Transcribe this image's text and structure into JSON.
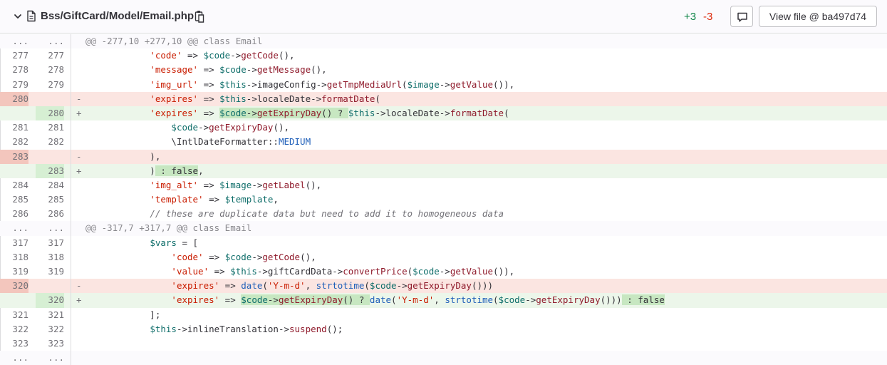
{
  "header": {
    "file_path": "Bss/GiftCard/Model/Email.php",
    "added": "+3",
    "removed": "-3",
    "view_file_label": "View file @ ba497d74",
    "icons": [
      "chevron-down-icon",
      "file-icon",
      "copy-icon",
      "comment-icon"
    ],
    "colors": {
      "added": "#108548",
      "removed": "#dd2b0e"
    }
  },
  "diff": {
    "lines": [
      {
        "type": "match",
        "old": "...",
        "new": "...",
        "marker": "",
        "code": "@@ -277,10 +277,10 @@ class Email"
      },
      {
        "type": "ctx",
        "old": "277",
        "new": "277",
        "marker": "",
        "code": "            'code' => $code->getCode(),"
      },
      {
        "type": "ctx",
        "old": "278",
        "new": "278",
        "marker": "",
        "code": "            'message' => $code->getMessage(),"
      },
      {
        "type": "ctx",
        "old": "279",
        "new": "279",
        "marker": "",
        "code": "            'img_url' => $this->imageConfig->getTmpMediaUrl($image->getValue()),"
      },
      {
        "type": "old",
        "old": "280",
        "new": "",
        "marker": "-",
        "code": "            'expires' => $this->localeDate->formatDate("
      },
      {
        "type": "new",
        "old": "",
        "new": "280",
        "marker": "+",
        "code": "            'expires' => $code->getExpiryDay() ? $this->localeDate->formatDate("
      },
      {
        "type": "ctx",
        "old": "281",
        "new": "281",
        "marker": "",
        "code": "                $code->getExpiryDay(),"
      },
      {
        "type": "ctx",
        "old": "282",
        "new": "282",
        "marker": "",
        "code": "                \\IntlDateFormatter::MEDIUM"
      },
      {
        "type": "old",
        "old": "283",
        "new": "",
        "marker": "-",
        "code": "            ),"
      },
      {
        "type": "new",
        "old": "",
        "new": "283",
        "marker": "+",
        "code": "            ) : false,"
      },
      {
        "type": "ctx",
        "old": "284",
        "new": "284",
        "marker": "",
        "code": "            'img_alt' => $image->getLabel(),"
      },
      {
        "type": "ctx",
        "old": "285",
        "new": "285",
        "marker": "",
        "code": "            'template' => $template,"
      },
      {
        "type": "ctx",
        "old": "286",
        "new": "286",
        "marker": "",
        "code": "            // these are duplicate data but need to add it to homogeneous data"
      },
      {
        "type": "match",
        "old": "...",
        "new": "...",
        "marker": "",
        "code": "@@ -317,7 +317,7 @@ class Email"
      },
      {
        "type": "ctx",
        "old": "317",
        "new": "317",
        "marker": "",
        "code": "            $vars = ["
      },
      {
        "type": "ctx",
        "old": "318",
        "new": "318",
        "marker": "",
        "code": "                'code' => $code->getCode(),"
      },
      {
        "type": "ctx",
        "old": "319",
        "new": "319",
        "marker": "",
        "code": "                'value' => $this->giftCardData->convertPrice($code->getValue()),"
      },
      {
        "type": "old",
        "old": "320",
        "new": "",
        "marker": "-",
        "code": "                'expires' => date('Y-m-d', strtotime($code->getExpiryDay()))"
      },
      {
        "type": "new",
        "old": "",
        "new": "320",
        "marker": "+",
        "code": "                'expires' => $code->getExpiryDay() ? date('Y-m-d', strtotime($code->getExpiryDay())) : false"
      },
      {
        "type": "ctx",
        "old": "321",
        "new": "321",
        "marker": "",
        "code": "            ];"
      },
      {
        "type": "ctx",
        "old": "322",
        "new": "322",
        "marker": "",
        "code": "            $this->inlineTranslation->suspend();"
      },
      {
        "type": "ctx",
        "old": "323",
        "new": "323",
        "marker": "",
        "code": ""
      },
      {
        "type": "match",
        "old": "...",
        "new": "...",
        "marker": "",
        "code": ""
      }
    ]
  }
}
